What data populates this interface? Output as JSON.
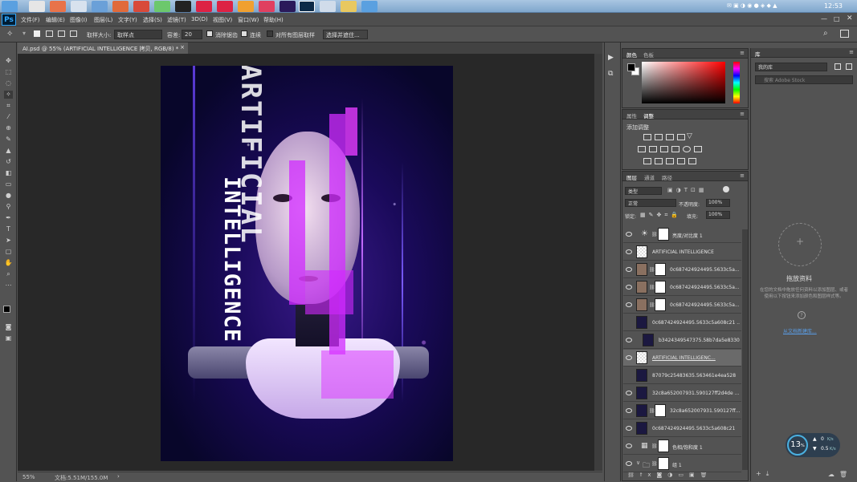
{
  "window": {
    "app": "Ps",
    "clock": "12:53"
  },
  "menu": [
    "文件(F)",
    "编辑(E)",
    "图像(I)",
    "图层(L)",
    "文字(Y)",
    "选择(S)",
    "滤镜(T)",
    "3D(D)",
    "视图(V)",
    "窗口(W)",
    "帮助(H)"
  ],
  "options": {
    "sample_size_label": "取样大小:",
    "sample_size_value": "取样点",
    "tolerance_label": "容差:",
    "tolerance_value": "20",
    "antialias": "消除锯齿",
    "contiguous": "连续",
    "all_layers": "对所有图层取样",
    "select_mask": "选择并遮住..."
  },
  "document": {
    "tab": "AI.psd @ 55% (ARTIFICIAL         INTELLIGENCE 拷贝, RGB/8) *",
    "close": "×"
  },
  "status": {
    "zoom": "55%",
    "doc_size": "文档:5.51M/155.0M"
  },
  "artwork": {
    "text1": "ARTIFICIAL",
    "text2": "INTELLIGENCE"
  },
  "panels": {
    "color": {
      "tabs": [
        "颜色",
        "色板"
      ]
    },
    "adjust": {
      "tabs": [
        "属性",
        "调整"
      ],
      "title": "添加调整"
    },
    "layers": {
      "tabs": [
        "图层",
        "通道",
        "路径"
      ],
      "filter": "类型",
      "blend_mode": "正常",
      "opacity_label": "不透明度:",
      "opacity": "100%",
      "lock_label": "锁定:",
      "fill_label": "填充:",
      "fill": "100%",
      "items": [
        {
          "name": "亮度/对比度 1",
          "eye": true,
          "thumb": "adj"
        },
        {
          "name": "ARTIFICIAL         INTELLIGENCE",
          "eye": true,
          "thumb": "trans"
        },
        {
          "name": "0c687424924495.5633c5a...",
          "eye": true,
          "thumb": "photo"
        },
        {
          "name": "0c687424924495.5633c5a...",
          "eye": true,
          "thumb": "photo"
        },
        {
          "name": "0c687424924495.5633c5a...",
          "eye": true,
          "thumb": "photo"
        },
        {
          "name": "0c687424924495.5633c5a608c21 ...",
          "eye": false,
          "thumb": "dark"
        },
        {
          "name": "b3424349547375.58b7da5e8330c",
          "eye": true,
          "thumb": "dark"
        },
        {
          "name": "ARTIFICIAL         INTELLIGENC...",
          "eye": true,
          "thumb": "trans"
        },
        {
          "name": "87079c25483635.563461e4ea528",
          "eye": false,
          "thumb": "dark"
        },
        {
          "name": "32c8a652007931.590127ff2d4de ...",
          "eye": true,
          "thumb": "dark"
        },
        {
          "name": "32c8a652007931.590127ff...",
          "eye": true,
          "thumb": "dark"
        },
        {
          "name": "0c687424924495.5633c5a608c21",
          "eye": true,
          "thumb": "dark"
        },
        {
          "name": "色相/饱和度 1",
          "eye": true,
          "thumb": "adj"
        },
        {
          "name": "组 1",
          "eye": true,
          "thumb": "folder"
        }
      ]
    },
    "library": {
      "tab": "库",
      "select": "我的库",
      "search": "搜索 Adobe Stock",
      "drop_title": "拖放资料",
      "drop_desc": "在您的文档中拖放任何资料以添加图层、或者使用以下按钮来添加颜色和图层样式等。",
      "link": "从文档新建库..."
    }
  },
  "widget": {
    "percent": "13",
    "percent_unit": "%",
    "up": "0",
    "up_unit": "K/s",
    "down": "0.5",
    "down_unit": "K/s"
  },
  "colors": {
    "accent": "#31a8ff",
    "panel": "#535353",
    "dark": "#282828"
  }
}
